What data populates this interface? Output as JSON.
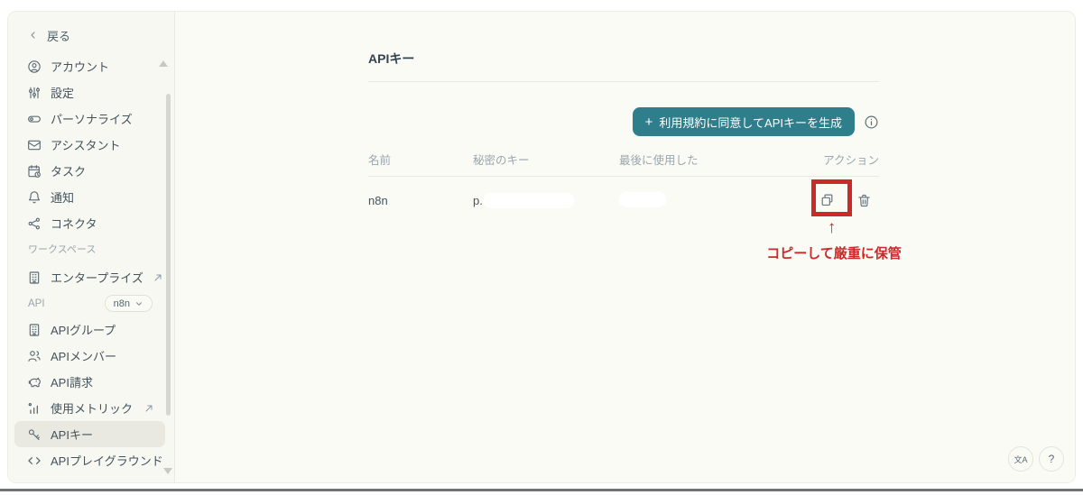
{
  "colors": {
    "accent_teal": "#2f7e8b",
    "annotation_red": "#cb2a2a"
  },
  "sidebar": {
    "back_label": "戻る",
    "items": [
      {
        "label": "アカウント"
      },
      {
        "label": "設定"
      },
      {
        "label": "パーソナライズ"
      },
      {
        "label": "アシスタント"
      },
      {
        "label": "タスク"
      },
      {
        "label": "通知"
      },
      {
        "label": "コネクタ"
      }
    ],
    "workspace": {
      "section_label": "ワークスペース",
      "items": [
        {
          "label": "エンタープライズ"
        }
      ]
    },
    "api": {
      "section_label": "API",
      "selector_value": "n8n",
      "items": [
        {
          "label": "APIグループ"
        },
        {
          "label": "APIメンバー"
        },
        {
          "label": "API請求"
        },
        {
          "label": "使用メトリック"
        },
        {
          "label": "APIキー",
          "selected": true
        },
        {
          "label": "APIプレイグラウンド"
        }
      ]
    }
  },
  "main": {
    "title": "APIキー",
    "generate_button": {
      "plus": "+",
      "label": "利用規約に同意してAPIキーを生成"
    },
    "table": {
      "headers": [
        "名前",
        "秘密のキー",
        "最後に使用した",
        "アクション"
      ],
      "row": {
        "name": "n8n",
        "secret_key_visible_prefix": "p."
      }
    },
    "annotation": {
      "arrow": "↑",
      "caption": "コピーして厳重に保管"
    }
  },
  "floating": {
    "translate_label": "文A",
    "help_label": "?"
  }
}
